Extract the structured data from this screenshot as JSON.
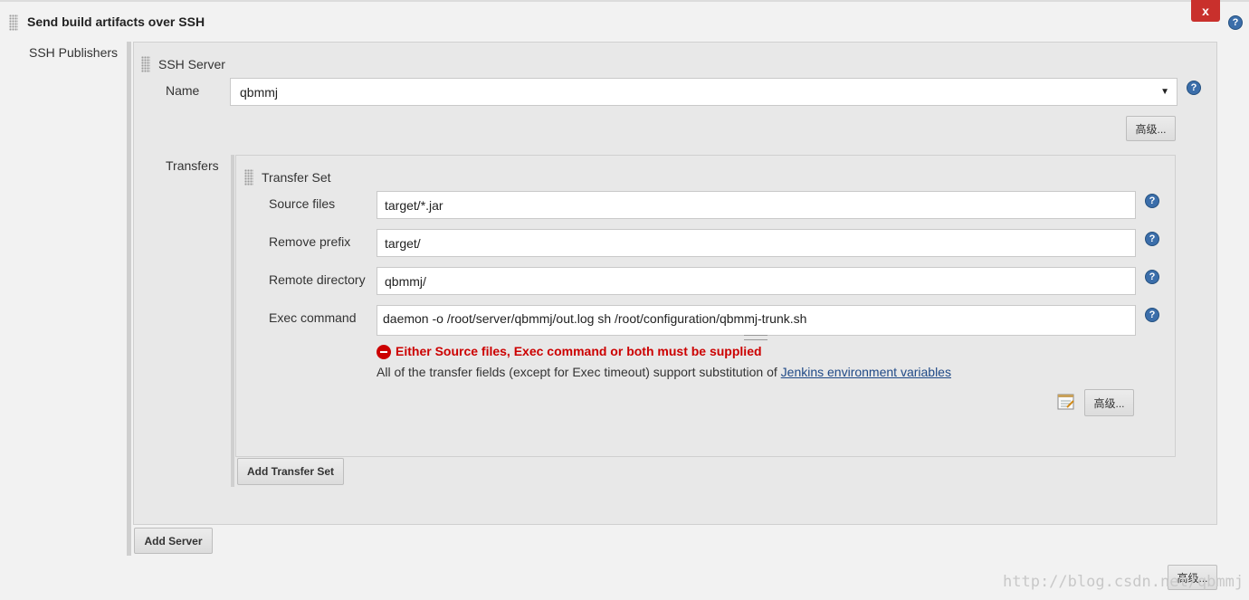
{
  "header": {
    "title": "Send build artifacts over SSH",
    "close_label": "x"
  },
  "ssh_publishers": {
    "label": "SSH Publishers",
    "server": {
      "section_title": "SSH Server",
      "name_label": "Name",
      "name_value": "qbmmj",
      "advanced_label": "高级...",
      "transfers_label": "Transfers",
      "transfer_set": {
        "section_title": "Transfer Set",
        "source_files_label": "Source files",
        "source_files_value": "target/*.jar",
        "remove_prefix_label": "Remove prefix",
        "remove_prefix_value": "target/",
        "remote_directory_label": "Remote directory",
        "remote_directory_value": "qbmmj/",
        "exec_command_label": "Exec command",
        "exec_command_value": "daemon -o /root/server/qbmmj/out.log sh /root/configuration/qbmmj-trunk.sh",
        "error_message": "Either Source files, Exec command or both must be supplied",
        "note_text": "All of the transfer fields (except for Exec timeout) support substitution of ",
        "note_link": "Jenkins environment variables",
        "advanced_label": "高级..."
      },
      "add_transfer_set_label": "Add Transfer Set"
    },
    "add_server_label": "Add Server",
    "advanced_label": "高级..."
  },
  "help_glyph": "?",
  "watermark": "http://blog.csdn.net/qbmmj"
}
